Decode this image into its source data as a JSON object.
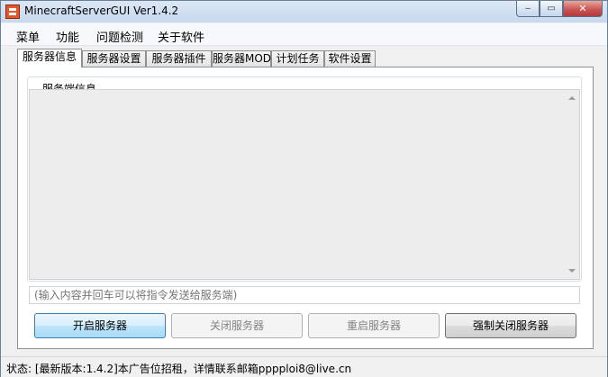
{
  "window": {
    "title": "MinecraftServerGUI Ver1.4.2"
  },
  "titlebar_icons": {
    "app": "minecraft-server-icon",
    "minimize": "minimize-icon",
    "maximize": "maximize-icon",
    "close": "close-icon"
  },
  "menu": {
    "items": [
      "菜单",
      "功能",
      "问题检测",
      "关于软件"
    ]
  },
  "tabs": [
    "服务器信息",
    "服务器设置",
    "服务器插件",
    "服务器MOD",
    "计划任务",
    "软件设置"
  ],
  "active_tab": "服务器信息",
  "server_info": {
    "group_label": "服务端信息",
    "log_text": "",
    "command_placeholder": "(输入内容并回车可以将指令发送给服务端)"
  },
  "buttons": {
    "start": "开启服务器",
    "stop": "关闭服务器",
    "restart": "重启服务器",
    "force_stop": "强制关闭服务器"
  },
  "status": {
    "text": "状态: [最新版本:1.4.2]本广告位招租，详情联系邮箱pppploi8@live.cn"
  },
  "colors": {
    "primary_button": "#bee6fd",
    "disabled_text": "#838383"
  }
}
